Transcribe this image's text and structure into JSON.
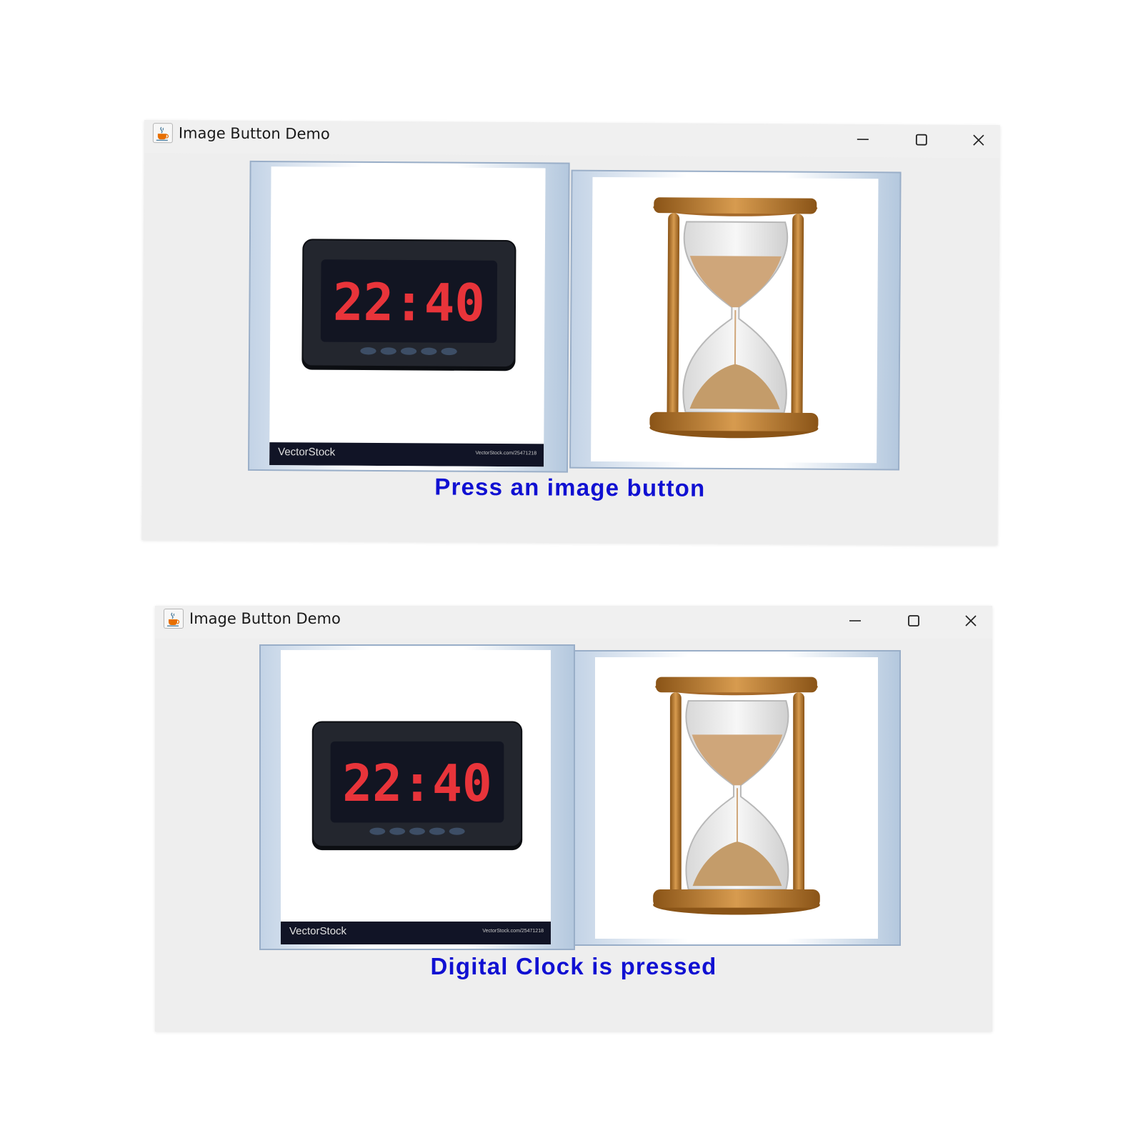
{
  "windows": [
    {
      "title": "Image Button Demo",
      "buttons": {
        "digital_clock": {
          "clock_time": "22:40",
          "watermark_brand": "VectorStock",
          "watermark_url": "VectorStock.com/25471218"
        },
        "hourglass": {}
      },
      "status_text": "Press an image button"
    },
    {
      "title": "Image Button Demo",
      "buttons": {
        "digital_clock": {
          "clock_time": "22:40",
          "watermark_brand": "VectorStock",
          "watermark_url": "VectorStock.com/25471218"
        },
        "hourglass": {}
      },
      "status_text": "Digital Clock is pressed"
    }
  ],
  "icons": {
    "app": "java-cup-icon",
    "minimize": "minimize-icon",
    "maximize": "maximize-icon",
    "close": "close-icon"
  },
  "colors": {
    "status_text": "#1010d2",
    "window_background": "#eeeeee",
    "clock_digits": "#e8343a",
    "clock_body": "#1b1d24"
  }
}
